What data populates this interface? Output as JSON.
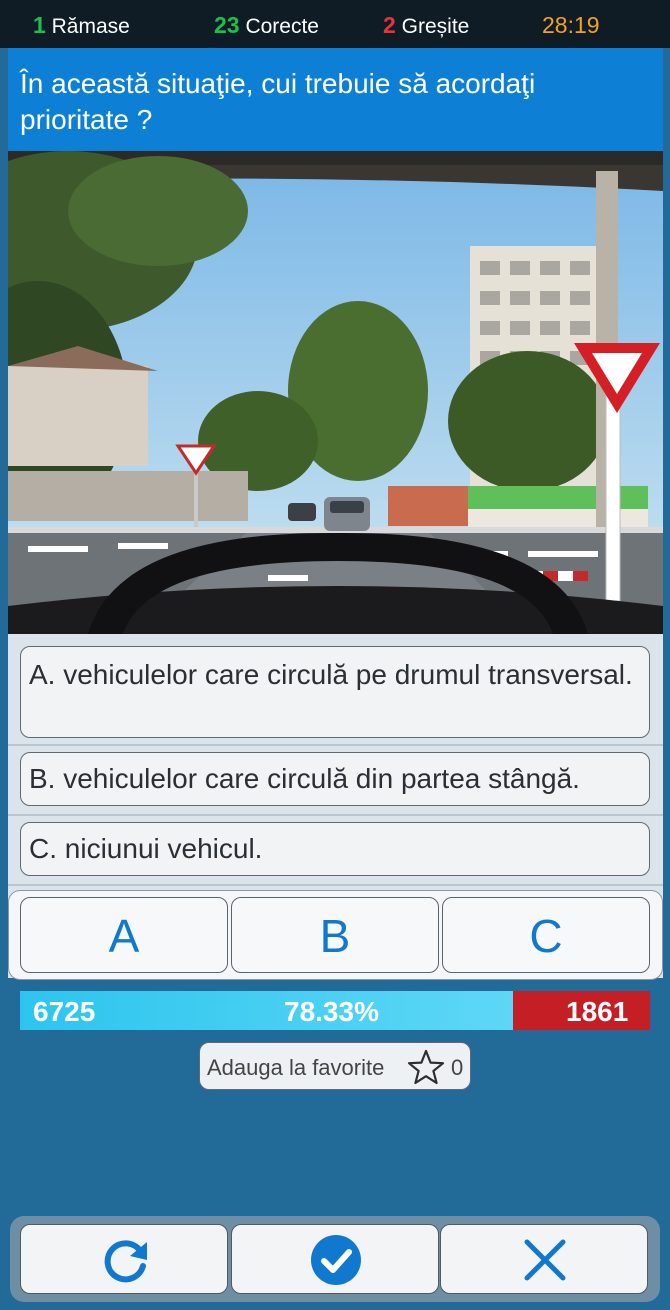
{
  "status": {
    "remaining_count": "1",
    "remaining_label": "Rămase",
    "correct_count": "23",
    "correct_label": "Corecte",
    "wrong_count": "2",
    "wrong_label": "Greșite",
    "timer": "28:19"
  },
  "question": {
    "text": "În această situaţie, cui trebuie să acordaţi prioritate ?"
  },
  "answers": [
    {
      "text": "A.  vehiculelor care circulă pe drumul transversal."
    },
    {
      "text": "B.  vehiculelor care circulă din partea stângă."
    },
    {
      "text": "C. niciunui vehicul."
    }
  ],
  "choices": [
    "A",
    "B",
    "C"
  ],
  "stats": {
    "left_value": "6725",
    "percent": "78.33%",
    "right_value": "1861",
    "fill_fraction": 0.7833
  },
  "favorite": {
    "label": "Adauga la favorite",
    "count": "0"
  },
  "icons": {
    "restart": "refresh-icon",
    "submit": "check-circle-icon",
    "cancel": "close-icon",
    "favorite": "star-outline-icon"
  },
  "colors": {
    "correct": "#19c24a",
    "wrong": "#e43636",
    "timer": "#f3a11f",
    "accent": "#1178cf",
    "question_bg": "#0d80d6"
  }
}
